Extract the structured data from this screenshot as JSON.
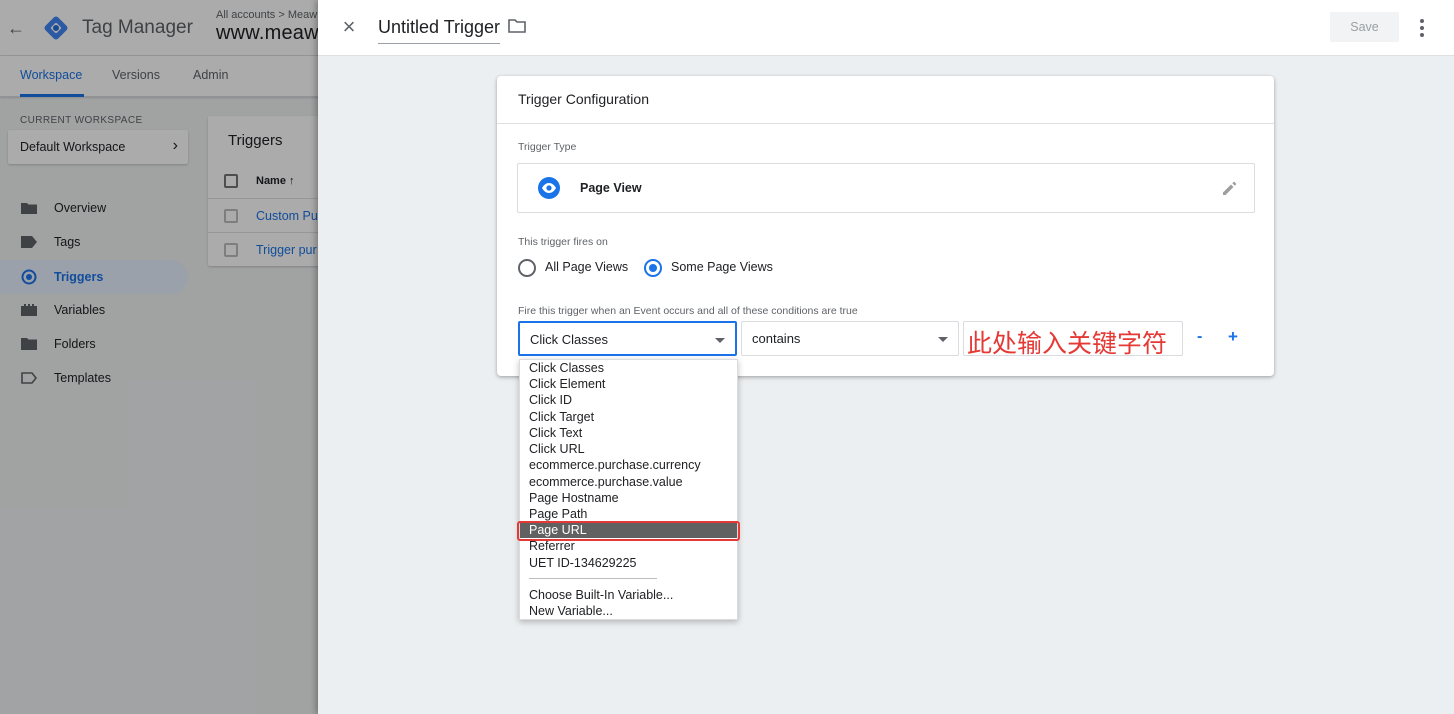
{
  "app": {
    "product_name": "Tag Manager",
    "breadcrumb": "All accounts > Meaw",
    "container_name": "www.meaw",
    "back_icon": "back-arrow-icon",
    "tabs": [
      "Workspace",
      "Versions",
      "Admin"
    ],
    "active_tab": "Workspace",
    "workspace_label": "CURRENT WORKSPACE",
    "workspace_name": "Default Workspace",
    "nav": [
      {
        "label": "Overview",
        "icon": "overview-icon"
      },
      {
        "label": "Tags",
        "icon": "tag-icon"
      },
      {
        "label": "Triggers",
        "icon": "triggers-icon",
        "active": true
      },
      {
        "label": "Variables",
        "icon": "variables-icon"
      },
      {
        "label": "Folders",
        "icon": "folder-icon"
      },
      {
        "label": "Templates",
        "icon": "templates-icon"
      }
    ],
    "triggers_card": {
      "title": "Triggers",
      "column_name": "Name ↑",
      "rows": [
        "Custom Pu",
        "Trigger pur"
      ]
    },
    "accent_color": "#1a73e8"
  },
  "editor": {
    "title": "Untitled Trigger",
    "save_label": "Save",
    "card_title": "Trigger Configuration",
    "trigger_type_label": "Trigger Type",
    "trigger_type": "Page View",
    "fires_on_label": "This trigger fires on",
    "fires_on_options": [
      "All Page Views",
      "Some Page Views"
    ],
    "fires_on_selected": "Some Page Views",
    "condition_label": "Fire this trigger when an Event occurs and all of these conditions are true",
    "condition": {
      "variable": "Click Classes",
      "operator": "contains",
      "value": "此处输入关键字符"
    },
    "remove_label": "-",
    "add_label": "+",
    "dropdown": {
      "items": [
        "Click Classes",
        "Click Element",
        "Click ID",
        "Click Target",
        "Click Text",
        "Click URL",
        "ecommerce.purchase.currency",
        "ecommerce.purchase.value",
        "Page Hostname",
        "Page Path",
        "Page URL",
        "Referrer",
        "UET ID-134629225"
      ],
      "highlighted": "Page URL",
      "extra": [
        "Choose Built-In Variable...",
        "New Variable..."
      ]
    },
    "annotation_color": "#e53935"
  }
}
